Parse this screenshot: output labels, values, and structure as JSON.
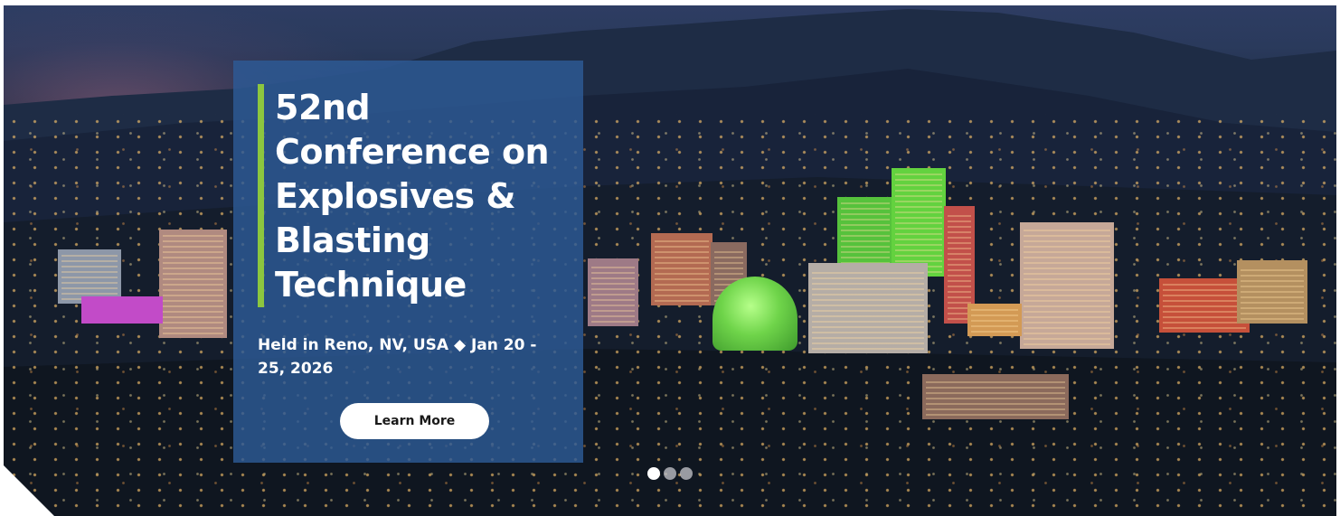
{
  "hero": {
    "title": "52nd Conference on Explosives & Blasting Technique",
    "event_info": "Held in Reno, NV, USA ◆ Jan 20 - 25, 2026",
    "cta_label": "Learn More",
    "accent_color": "#8cc63f",
    "panel_color": "#2d5a96"
  },
  "carousel": {
    "slide_count": 3,
    "active_index": 0
  }
}
